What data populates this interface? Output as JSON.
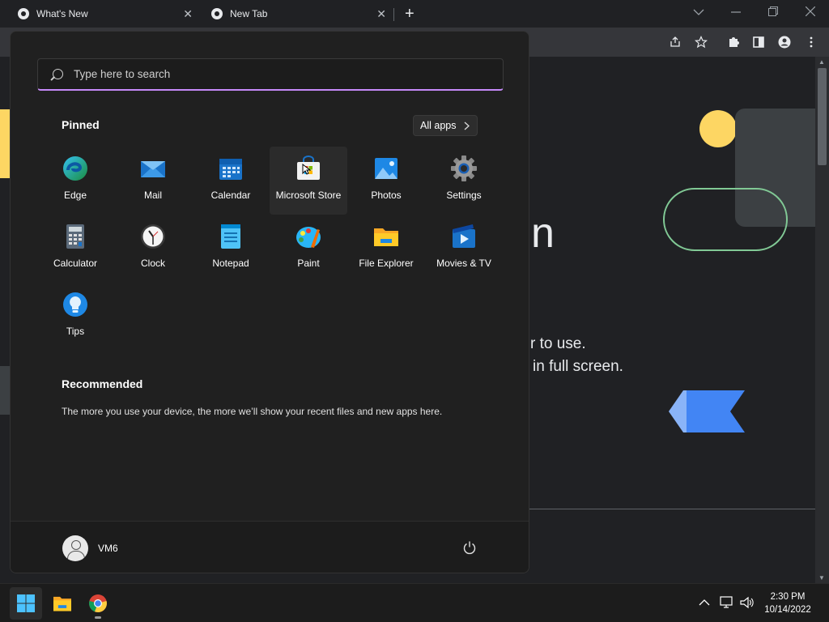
{
  "browser": {
    "tabs": [
      {
        "title": "What's New"
      },
      {
        "title": "New Tab"
      }
    ],
    "close_glyph": "✕",
    "new_tab_glyph": "+"
  },
  "page_background": {
    "heading_fragment": "n",
    "line1": "r to use.",
    "line2": "in full screen."
  },
  "start_menu": {
    "search_placeholder": "Type here to search",
    "pinned_title": "Pinned",
    "all_apps_label": "All apps",
    "pinned_apps": [
      {
        "label": "Edge",
        "icon": "edge-icon"
      },
      {
        "label": "Mail",
        "icon": "mail-icon"
      },
      {
        "label": "Calendar",
        "icon": "calendar-icon"
      },
      {
        "label": "Microsoft Store",
        "icon": "store-icon"
      },
      {
        "label": "Photos",
        "icon": "photos-icon"
      },
      {
        "label": "Settings",
        "icon": "settings-icon"
      },
      {
        "label": "Calculator",
        "icon": "calculator-icon"
      },
      {
        "label": "Clock",
        "icon": "clock-icon"
      },
      {
        "label": "Notepad",
        "icon": "notepad-icon"
      },
      {
        "label": "Paint",
        "icon": "paint-icon"
      },
      {
        "label": "File Explorer",
        "icon": "file-explorer-icon"
      },
      {
        "label": "Movies & TV",
        "icon": "movies-tv-icon"
      },
      {
        "label": "Tips",
        "icon": "tips-icon"
      }
    ],
    "recommended_title": "Recommended",
    "recommended_text": "The more you use your device, the more we’ll show your recent files and new apps here.",
    "user_name": "VM6"
  },
  "taskbar": {
    "time": "2:30 PM",
    "date": "10/14/2022"
  },
  "colors": {
    "accent_underline": "#c58af9",
    "menu_bg": "#202020",
    "taskbar_bg": "#1c1c1c"
  }
}
